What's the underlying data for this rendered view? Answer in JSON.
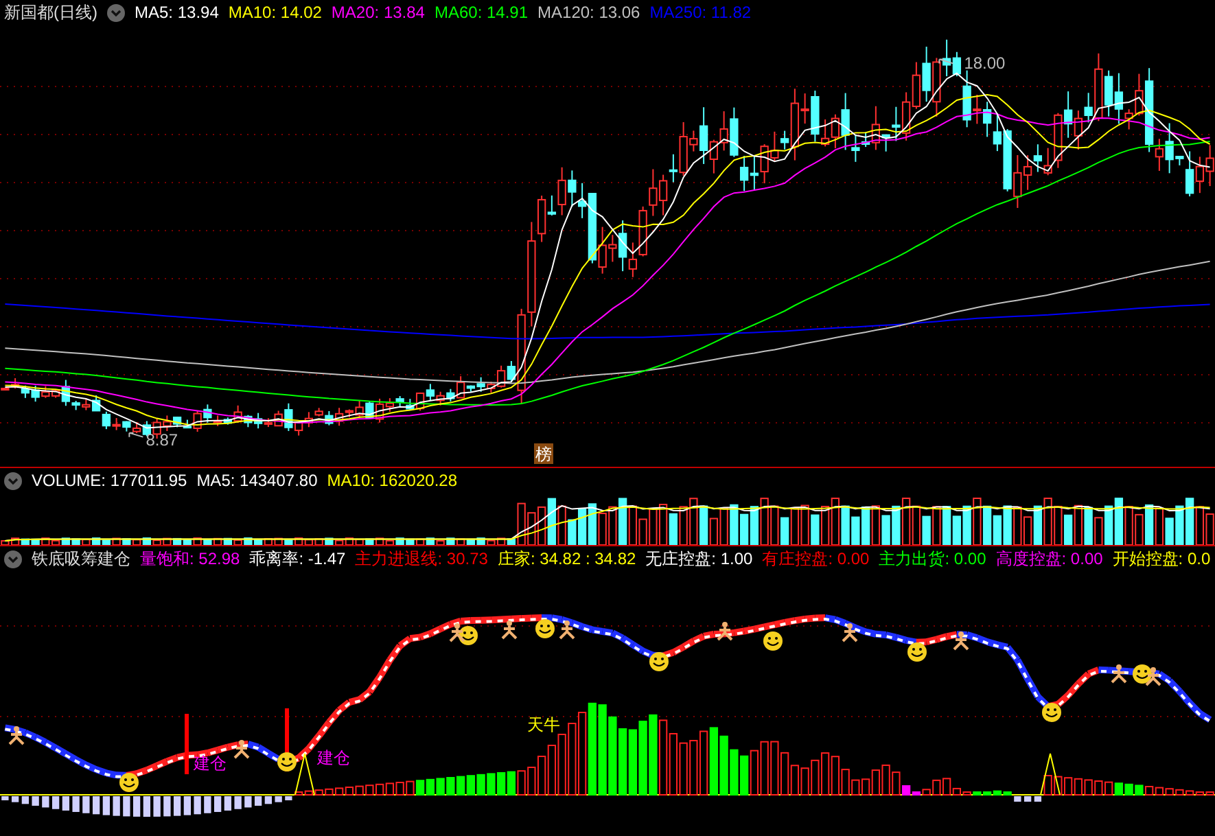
{
  "price_panel": {
    "title": "新国都(日线)",
    "indicators": [
      {
        "label": "MA5: 13.94",
        "color": "#ffffff"
      },
      {
        "label": "MA10: 14.02",
        "color": "#ffff00"
      },
      {
        "label": "MA20: 13.84",
        "color": "#ff00ff"
      },
      {
        "label": "MA60: 14.91",
        "color": "#00ff00"
      },
      {
        "label": "MA120: 13.06",
        "color": "#c0c0c0"
      },
      {
        "label": "MA250: 11.82",
        "color": "#0000ff"
      }
    ],
    "high_label": "18.00",
    "low_label": "8.87",
    "badge": "榜"
  },
  "volume_panel": {
    "indicators": [
      {
        "label": "VOLUME: 177011.95",
        "color": "#ffffff"
      },
      {
        "label": "MA5: 143407.80",
        "color": "#ffffff"
      },
      {
        "label": "MA10: 162020.28",
        "color": "#ffff00"
      }
    ]
  },
  "indicator_panel": {
    "title": "铁底吸筹建仓",
    "indicators": [
      {
        "label": "量饱和: 52.98",
        "color": "#ff00ff"
      },
      {
        "label": "乖离率: -1.47",
        "color": "#ffffff"
      },
      {
        "label": "主力进退线: 30.73",
        "color": "#ff0000"
      },
      {
        "label": "庄家: 34.82 : 34.82",
        "color": "#ffff00"
      },
      {
        "label": "无庄控盘: 1.00",
        "color": "#ffffff"
      },
      {
        "label": "有庄控盘: 0.00",
        "color": "#ff0000"
      },
      {
        "label": "主力出货: 0.00",
        "color": "#00ff00"
      },
      {
        "label": "高度控盘: 0.00",
        "color": "#ff00ff"
      },
      {
        "label": "开始控盘: 0.0",
        "color": "#ffff00"
      }
    ],
    "signals": [
      {
        "label": "建仓",
        "color": "#ff00ff"
      },
      {
        "label": "建仓",
        "color": "#ff00ff"
      },
      {
        "label": "天牛",
        "color": "#ffff00"
      }
    ]
  }
}
